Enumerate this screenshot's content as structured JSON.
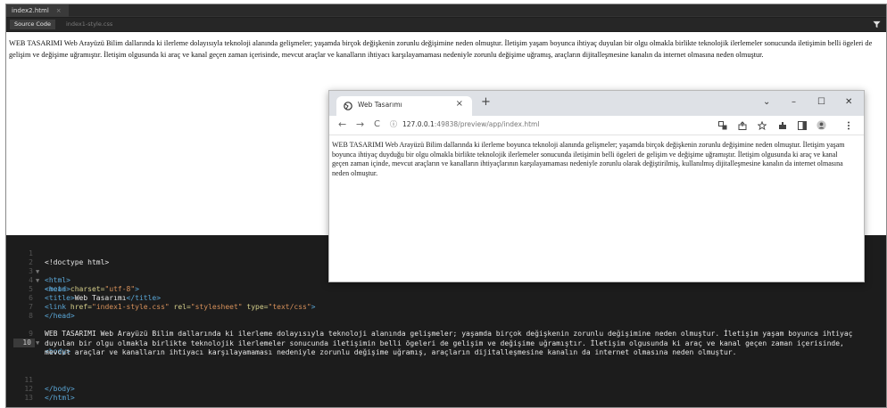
{
  "editor": {
    "file_tab": "index2.html",
    "file_tab_close": "×",
    "view_tabs": [
      "Source Code",
      "index1-style.css"
    ],
    "filter_icon": "filter-icon"
  },
  "preview": {
    "text": "WEB TASARIMI Web Arayüzü Bilim dallarında ki ilerleme dolayısıyla teknoloji alanında gelişmeler; yaşamda birçok değişkenin zorunlu değişimine neden olmuştur. İletişim yaşam boyunca ihtiyaç duyulan bir olgu olmakla birlikte teknolojik ilerlemeler sonucunda iletişimin belli ögeleri de gelişim ve değişime uğramıştır. İletişim olgusunda ki araç ve kanal geçen zaman içerisinde, mevcut araçlar ve kanalların ihtiyacı karşılayamaması nedeniyle zorunlu değişime uğramış, araçların dijitalleşmesine kanalın da internet olmasına neden olmuştur."
  },
  "code": {
    "lines": [
      {
        "n": "1",
        "fold": "",
        "html": "doctype"
      },
      {
        "n": "2",
        "fold": "▼",
        "html": "html"
      },
      {
        "n": "3",
        "fold": "▼",
        "html": "head"
      },
      {
        "n": "4",
        "fold": "",
        "html": "meta"
      },
      {
        "n": "5",
        "fold": "",
        "html": "title"
      },
      {
        "n": "6",
        "fold": "",
        "html": "link"
      },
      {
        "n": "7",
        "fold": "",
        "html": "headclose"
      },
      {
        "n": "8",
        "fold": "",
        "html": "blank"
      },
      {
        "n": "9",
        "fold": "▼",
        "html": "body"
      },
      {
        "n": "10",
        "fold": "",
        "html": "text"
      },
      {
        "n": "11",
        "fold": "",
        "html": "bodyclose"
      },
      {
        "n": "12",
        "fold": "",
        "html": "htmlclose"
      },
      {
        "n": "13",
        "fold": "",
        "html": "blank"
      }
    ],
    "doctype": "<!doctype html>",
    "html_open": "<html>",
    "head_open": "<head>",
    "meta_tag": "<meta ",
    "meta_attr": "charset=",
    "meta_val": "\"utf-8\"",
    "meta_end": ">",
    "title_open": "<title>",
    "title_text": "Web Tasarımı",
    "title_close": "</title>",
    "link_tag": "<link ",
    "link_href_attr": "href=",
    "link_href_val": "\"index1-style.css\"",
    "link_rel_attr": " rel=",
    "link_rel_val": "\"stylesheet\"",
    "link_type_attr": " type=",
    "link_type_val": "\"text/css\"",
    "link_end": ">",
    "head_close": "</head>",
    "body_open": "<body>",
    "body_text": "WEB TASARIMI Web Arayüzü Bilim dallarında ki ilerleme dolayısıyla teknoloji alanında gelişmeler; yaşamda birçok değişkenin zorunlu değişimine neden olmuştur. İletişim yaşam boyunca ihtiyaç duyulan bir olgu olmakla birlikte teknolojik ilerlemeler sonucunda iletişimin belli ögeleri de gelişim ve değişime uğramıştır. İletişim olgusunda ki araç ve kanal geçen zaman içerisinde, mevcut araçlar ve kanalların ihtiyacı karşılayamaması nedeniyle zorunlu değişime uğramış, araçların dijitalleşmesine kanalın da internet olmasına neden olmuştur.",
    "body_close": "</body>",
    "html_close": "</html>"
  },
  "browser": {
    "tab_title": "Web Tasarımı",
    "tab_close": "×",
    "new_tab": "+",
    "win_min": "–",
    "win_max": "☐",
    "win_close": "✕",
    "win_down": "⌄",
    "back": "←",
    "forward": "→",
    "reload": "C",
    "info": "ⓘ",
    "url_host": "127.0.0.1",
    "url_rest": ":49838/preview/app/index.html",
    "content": "WEB TASARIMI Web Arayüzü Bilim dallarında ki ilerleme boyunca teknoloji alanında gelişmeler; yaşamda birçok değişkenin zorunlu değişimine neden olmuştur. İletişim yaşam boyunca ihtiyaç duyduğu bir olgu olmakla birlikte teknolojik ilerlemeler sonucunda iletişimin belli ögeleri de gelişim ve değişime uğramıştır. İletişim olgusunda ki araç ve kanal geçen zaman içinde, mevcut araçların ve kanalların ihtiyaçlarının karşılayamaması nedeniyle zorunlu olarak değiştirilmiş, kullanılmış dijitalleşmesine kanalın da internet olmasına neden olmuştur."
  }
}
